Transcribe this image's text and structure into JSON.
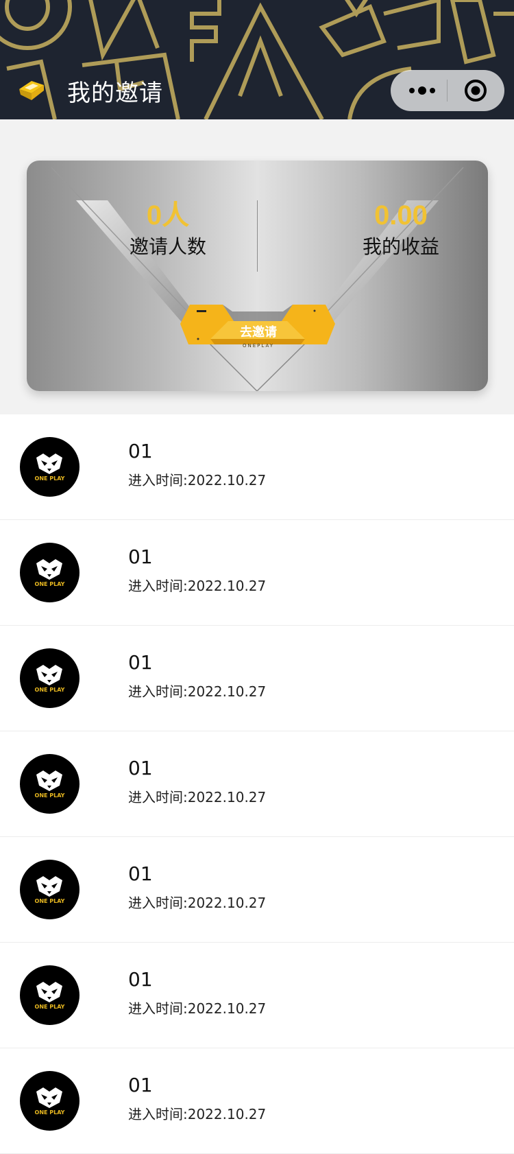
{
  "header": {
    "title": "我的邀请",
    "back_icon": "back-arrow-icon",
    "more_icon": "more-dots-icon",
    "close_icon": "target-close-icon",
    "background_color": "#1e2430",
    "pattern_color": "#c9b15f"
  },
  "summary": {
    "invite_count": "0人",
    "invite_count_label": "邀请人数",
    "earnings": "0.00",
    "earnings_label": "我的收益",
    "invite_button_label": "去邀请",
    "invite_button_brand": "ONEPLAY",
    "accent_color": "#f1c233",
    "button_color": "#f5b41a"
  },
  "records": [
    {
      "name": "01",
      "time": "进入时间:2022.10.27"
    },
    {
      "name": "01",
      "time": "进入时间:2022.10.27"
    },
    {
      "name": "01",
      "time": "进入时间:2022.10.27"
    },
    {
      "name": "01",
      "time": "进入时间:2022.10.27"
    },
    {
      "name": "01",
      "time": "进入时间:2022.10.27"
    },
    {
      "name": "01",
      "time": "进入时间:2022.10.27"
    },
    {
      "name": "01",
      "time": "进入时间:2022.10.27"
    }
  ],
  "avatar_brand": "ONE PLAY"
}
